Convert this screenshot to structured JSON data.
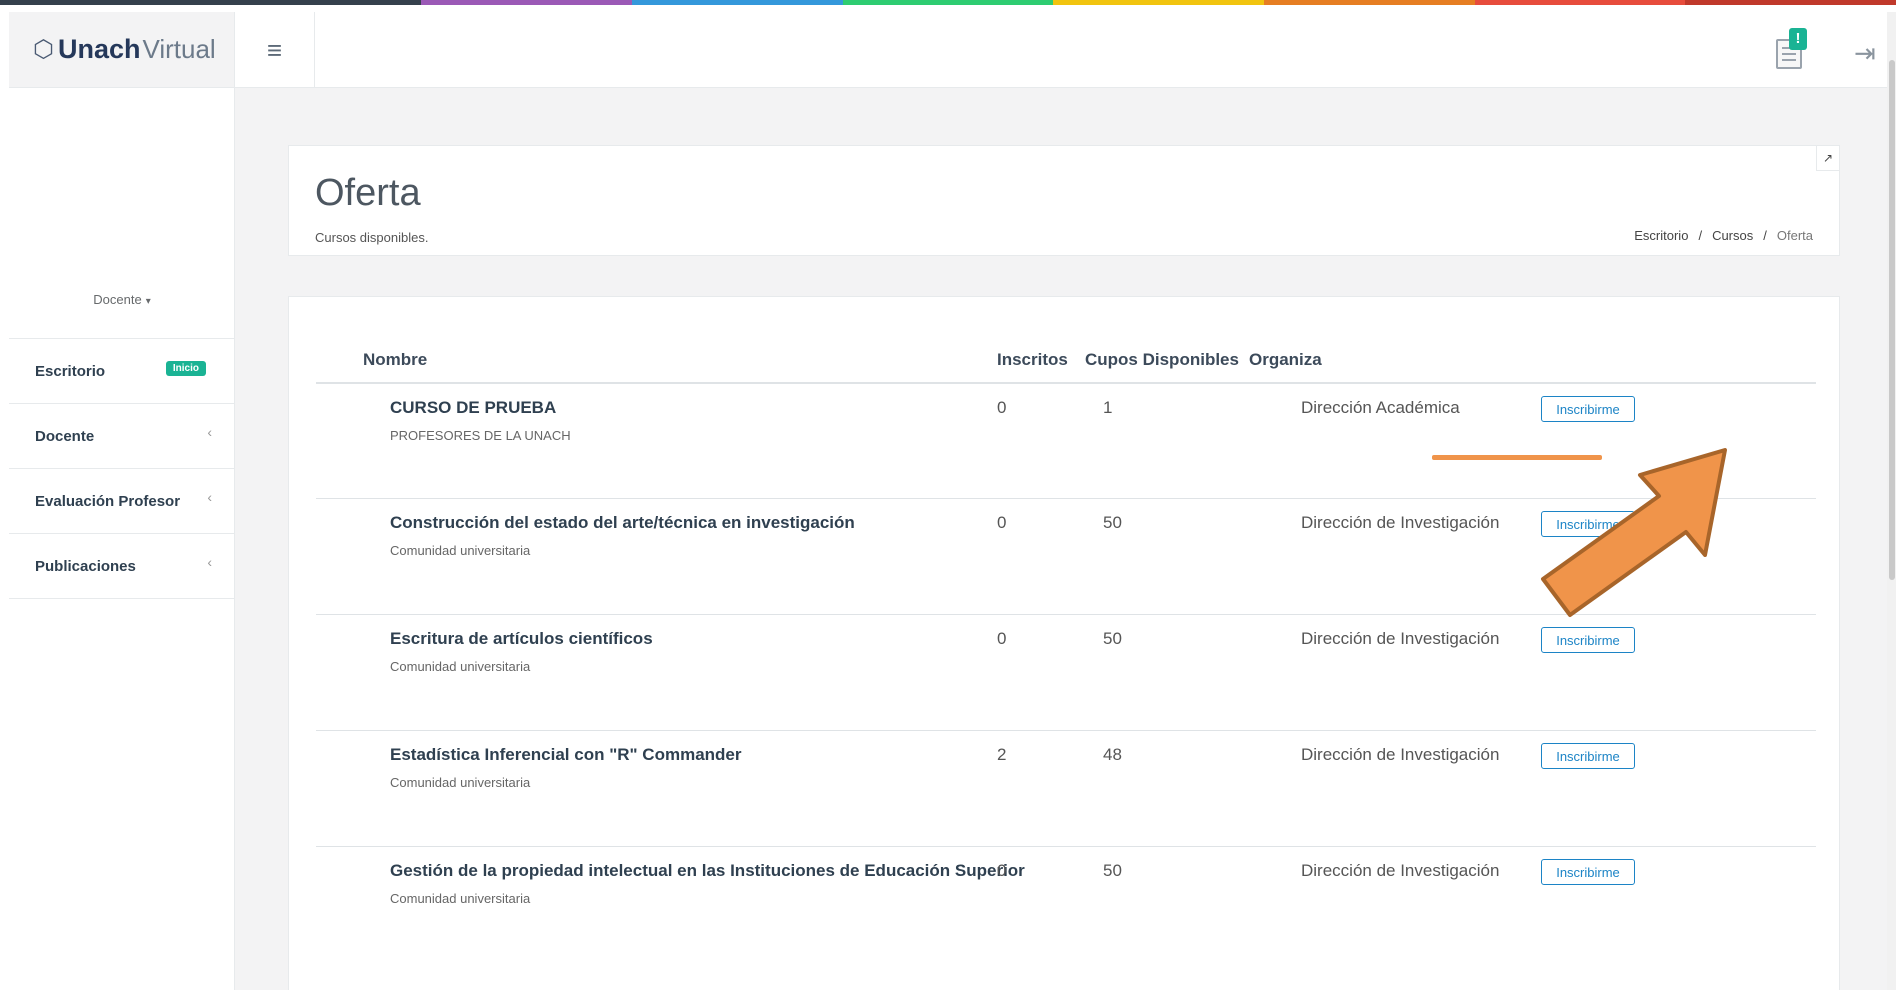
{
  "app": {
    "logo_bold": "Unach",
    "logo_light": "Virtual",
    "top_colors": [
      "#35404c",
      "#35404c",
      "#9b59b6",
      "#3498db",
      "#2ecc71",
      "#f1c40f",
      "#e67e22",
      "#e74c3c",
      "#c0392b"
    ]
  },
  "sidebar": {
    "role": "Docente",
    "items": [
      {
        "label": "Escritorio",
        "badge": "Inicio"
      },
      {
        "label": "Docente",
        "chevron": "‹"
      },
      {
        "label": "Evaluación Profesor",
        "chevron": "‹"
      },
      {
        "label": "Publicaciones",
        "chevron": "‹"
      }
    ]
  },
  "header": {
    "menu_icon": "≡",
    "notification_badge": "!",
    "logout_icon": "⇥"
  },
  "page": {
    "title": "Oferta",
    "subtitle": "Cursos disponibles.",
    "breadcrumb": [
      "Escritorio",
      "Cursos",
      "Oferta"
    ],
    "breadcrumb_sep": "/"
  },
  "table": {
    "headers": {
      "nombre": "Nombre",
      "inscritos": "Inscritos",
      "cupos": "Cupos Disponibles",
      "organiza": "Organiza"
    },
    "action_label": "Inscribirme",
    "rows": [
      {
        "name": "CURSO DE PRUEBA",
        "audience": "PROFESORES DE LA UNACH",
        "inscritos": "0",
        "cupos": "1",
        "organiza": "Dirección Académica"
      },
      {
        "name": "Construcción del estado del arte/técnica en investigación",
        "audience": "Comunidad universitaria",
        "inscritos": "0",
        "cupos": "50",
        "organiza": "Dirección de Investigación"
      },
      {
        "name": "Escritura de artículos científicos",
        "audience": "Comunidad universitaria",
        "inscritos": "0",
        "cupos": "50",
        "organiza": "Dirección de Investigación"
      },
      {
        "name": "Estadística Inferencial con \"R\" Commander",
        "audience": "Comunidad universitaria",
        "inscritos": "2",
        "cupos": "48",
        "organiza": "Dirección de Investigación"
      },
      {
        "name": "Gestión de la propiedad intelectual en las Instituciones de Educación Superior",
        "audience": "Comunidad universitaria",
        "inscritos": "0",
        "cupos": "50",
        "organiza": "Dirección de Investigación"
      }
    ]
  },
  "annotation": {
    "color": "#f0944a",
    "stroke": "#a8652a",
    "icons": [
      "highlight-underline",
      "pointer-arrow"
    ]
  }
}
